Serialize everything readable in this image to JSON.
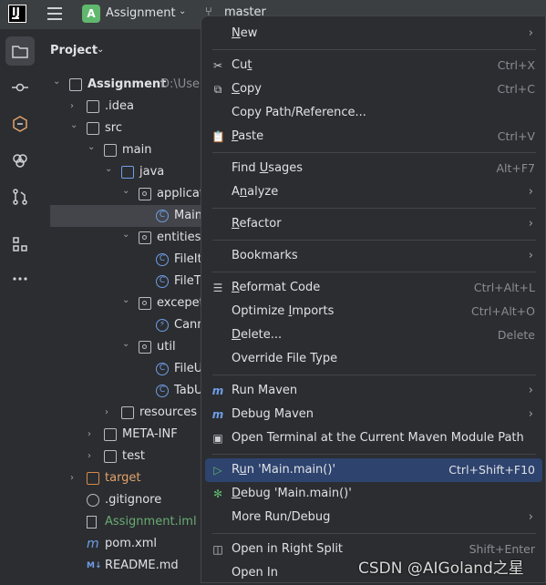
{
  "topbar": {
    "logo_letter": "IJ",
    "project_badge": "A",
    "project_name": "Assignment",
    "branch": "master"
  },
  "panel": {
    "title": "Project",
    "tree": [
      {
        "label": "Assignment",
        "extra": "D:\\User",
        "depth": 0,
        "arrow": "down",
        "icon": "module-folder"
      },
      {
        "label": ".idea",
        "depth": 1,
        "arrow": "right",
        "icon": "folder"
      },
      {
        "label": "src",
        "depth": 1,
        "arrow": "down",
        "icon": "folder"
      },
      {
        "label": "main",
        "depth": 2,
        "arrow": "down",
        "icon": "folder"
      },
      {
        "label": "java",
        "depth": 3,
        "arrow": "down",
        "icon": "folder-blue"
      },
      {
        "label": "applicat",
        "depth": 4,
        "arrow": "down",
        "icon": "package"
      },
      {
        "label": "Main",
        "depth": 5,
        "arrow": "",
        "icon": "class",
        "selected": true
      },
      {
        "label": "entities",
        "depth": 4,
        "arrow": "down",
        "icon": "package"
      },
      {
        "label": "FileIt",
        "depth": 5,
        "arrow": "",
        "icon": "class"
      },
      {
        "label": "FileT",
        "depth": 5,
        "arrow": "",
        "icon": "class"
      },
      {
        "label": "excepet",
        "depth": 4,
        "arrow": "down",
        "icon": "package"
      },
      {
        "label": "Cann",
        "depth": 5,
        "arrow": "",
        "icon": "exception"
      },
      {
        "label": "util",
        "depth": 4,
        "arrow": "down",
        "icon": "package"
      },
      {
        "label": "FileU",
        "depth": 5,
        "arrow": "",
        "icon": "class"
      },
      {
        "label": "TabU",
        "depth": 5,
        "arrow": "",
        "icon": "class"
      },
      {
        "label": "resources",
        "depth": 3,
        "arrow": "right",
        "icon": "folder"
      },
      {
        "label": "META-INF",
        "depth": 2,
        "arrow": "right",
        "icon": "folder"
      },
      {
        "label": "test",
        "depth": 2,
        "arrow": "right",
        "icon": "folder"
      },
      {
        "label": "target",
        "depth": 1,
        "arrow": "right",
        "icon": "folder-orange",
        "color": "orange"
      },
      {
        "label": ".gitignore",
        "depth": 1,
        "arrow": "",
        "icon": "gitignore"
      },
      {
        "label": "Assignment.iml",
        "depth": 1,
        "arrow": "",
        "icon": "file",
        "color": "green"
      },
      {
        "label": "pom.xml",
        "depth": 1,
        "arrow": "",
        "icon": "maven"
      },
      {
        "label": "README.md",
        "depth": 1,
        "arrow": "",
        "icon": "markdown"
      }
    ]
  },
  "menu": {
    "items": [
      {
        "id": "new",
        "label": "New",
        "u": 0,
        "sub": true
      },
      {
        "sep": true
      },
      {
        "id": "cut",
        "label": "Cut",
        "u": 2,
        "kb": "Ctrl+X",
        "icon": "✂"
      },
      {
        "id": "copy",
        "label": "Copy",
        "u": 0,
        "kb": "Ctrl+C",
        "icon": "⧉"
      },
      {
        "id": "copy-path",
        "label": "Copy Path/Reference...",
        "u": -1
      },
      {
        "id": "paste",
        "label": "Paste",
        "u": 0,
        "kb": "Ctrl+V",
        "icon": "📋"
      },
      {
        "sep": true
      },
      {
        "id": "find-usages",
        "label": "Find Usages",
        "u": 5,
        "kb": "Alt+F7"
      },
      {
        "id": "analyze",
        "label": "Analyze",
        "u": 1,
        "sub": true
      },
      {
        "sep": true
      },
      {
        "id": "refactor",
        "label": "Refactor",
        "u": 0,
        "sub": true
      },
      {
        "sep": true
      },
      {
        "id": "bookmarks",
        "label": "Bookmarks",
        "u": -1,
        "sub": true
      },
      {
        "sep": true
      },
      {
        "id": "reformat",
        "label": "Reformat Code",
        "u": 0,
        "kb": "Ctrl+Alt+L",
        "icon": "☰"
      },
      {
        "id": "optimize",
        "label": "Optimize Imports",
        "u": 9,
        "kb": "Ctrl+Alt+O"
      },
      {
        "id": "delete",
        "label": "Delete...",
        "u": 0,
        "kb": "Delete"
      },
      {
        "id": "override",
        "label": "Override File Type",
        "u": -1
      },
      {
        "sep": true
      },
      {
        "id": "run-maven",
        "label": "Run Maven",
        "u": -1,
        "sub": true,
        "icon": "m"
      },
      {
        "id": "debug-maven",
        "label": "Debug Maven",
        "u": -1,
        "sub": true,
        "icon": "m"
      },
      {
        "id": "open-terminal",
        "label": "Open Terminal at the Current Maven Module Path",
        "u": -1,
        "icon": "▣"
      },
      {
        "sep": true
      },
      {
        "id": "run-main",
        "label": "Run 'Main.main()'",
        "u": 1,
        "kb": "Ctrl+Shift+F10",
        "icon": "▷",
        "selected": true
      },
      {
        "id": "debug-main",
        "label": "Debug 'Main.main()'",
        "u": 0,
        "icon": "✻"
      },
      {
        "id": "more-run",
        "label": "More Run/Debug",
        "u": -1,
        "sub": true
      },
      {
        "sep": true
      },
      {
        "id": "open-split",
        "label": "Open in Right Split",
        "u": -1,
        "kb": "Shift+Enter",
        "icon": "◫"
      },
      {
        "id": "open-in",
        "label": "Open In",
        "u": -1
      }
    ]
  },
  "watermark": "CSDN @AIGoland之星"
}
